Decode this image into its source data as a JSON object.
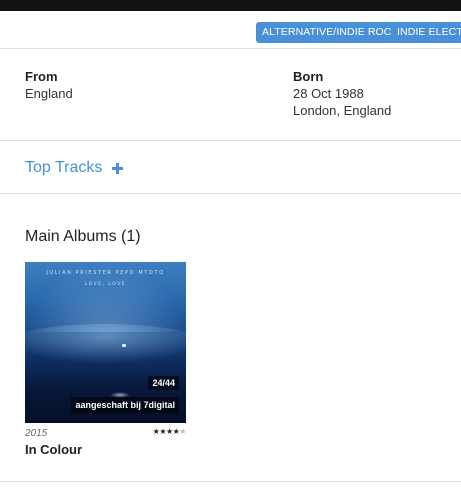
{
  "genres": [
    "ALTERNATIVE/INDIE ROCK",
    "INDIE ELECTRONIC"
  ],
  "info": {
    "from_label": "From",
    "from_value": "England",
    "born_label": "Born",
    "born_date": "28 Oct 1988",
    "born_place": "London, England"
  },
  "top_tracks": {
    "label": "Top Tracks",
    "icon": "plus-icon"
  },
  "albums_heading": "Main Albums (1)",
  "albums": [
    {
      "cover_artists": "JULIAN PRIESTER PEPO MTOTO",
      "cover_title": "LOVE, LOVE",
      "track_count": "24/44",
      "purchase_label": "aangeschaft bij 7digital",
      "year": "2015",
      "rating_filled": "★★★★",
      "rating_empty": "★",
      "rating": 4,
      "rating_max": 5,
      "title": "In Colour"
    }
  ],
  "colors": {
    "accent": "#4a90d9",
    "text": "#222222",
    "divider": "#e2e2e2"
  }
}
